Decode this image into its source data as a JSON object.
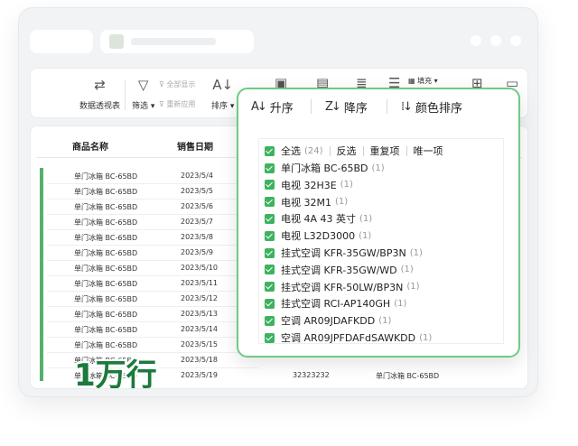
{
  "ribbon": {
    "pivot": "数据透视表",
    "filter": "筛选",
    "show_all": "全部显示",
    "reapply": "重新应用",
    "sort": "排序",
    "fill": "填充"
  },
  "sheet": {
    "col_product": "商品名称",
    "col_date": "销售日期",
    "rows": [
      {
        "product": "单门冰箱 BC-65BD",
        "date": "2023/5/4"
      },
      {
        "product": "单门冰箱 BC-65BD",
        "date": "2023/5/5"
      },
      {
        "product": "单门冰箱 BC-65BD",
        "date": "2023/5/6"
      },
      {
        "product": "单门冰箱 BC-65BD",
        "date": "2023/5/7"
      },
      {
        "product": "单门冰箱 BC-65BD",
        "date": "2023/5/8"
      },
      {
        "product": "单门冰箱 BC-65BD",
        "date": "2023/5/9"
      },
      {
        "product": "单门冰箱 BC-65BD",
        "date": "2023/5/10"
      },
      {
        "product": "单门冰箱 BC-65BD",
        "date": "2023/5/11"
      },
      {
        "product": "单门冰箱 BC-65BD",
        "date": "2023/5/12"
      },
      {
        "product": "单门冰箱 BC-65BD",
        "date": "2023/5/13"
      },
      {
        "product": "单门冰箱 BC-65BD",
        "date": "2023/5/14"
      },
      {
        "product": "单门冰箱 BC-65BD",
        "date": "2023/5/15"
      },
      {
        "product": "单门冰箱 BC-65BD",
        "date": "2023/5/18"
      },
      {
        "product": "单门冰箱 BC-65BD",
        "date": "2023/5/19",
        "code": "32323232",
        "product2": "单门冰箱 BC-65BD"
      }
    ],
    "big_label": "1万行"
  },
  "popup": {
    "sort_asc": "升序",
    "sort_desc": "降序",
    "sort_color": "颜色排序",
    "select_all": "全选",
    "select_all_count": "(24)",
    "invert": "反选",
    "duplicates": "重复项",
    "unique": "唯一项",
    "items": [
      {
        "label": "单门冰箱 BC-65BD",
        "count": "(1)"
      },
      {
        "label": "电视 32H3E",
        "count": "(1)"
      },
      {
        "label": "电视 32M1",
        "count": "(1)"
      },
      {
        "label": "电视 4A 43 英寸",
        "count": "(1)"
      },
      {
        "label": "电视 L32D3000",
        "count": "(1)"
      },
      {
        "label": "挂式空调 KFR-35GW/BP3N",
        "count": "(1)"
      },
      {
        "label": "挂式空调 KFR-35GW/WD",
        "count": "(1)"
      },
      {
        "label": "挂式空调 KFR-50LW/BP3N",
        "count": "(1)"
      },
      {
        "label": "挂式空调 RCI-AP140GH",
        "count": "(1)"
      },
      {
        "label": "空调 AR09JDAFKDD",
        "count": "(1)"
      },
      {
        "label": "空调 AR09JPFDAFdSAWKDD",
        "count": "(1)"
      }
    ]
  },
  "colors": {
    "accent": "#3db35f",
    "popup_border": "#6ccb84",
    "big_text": "#1b7a3c"
  }
}
